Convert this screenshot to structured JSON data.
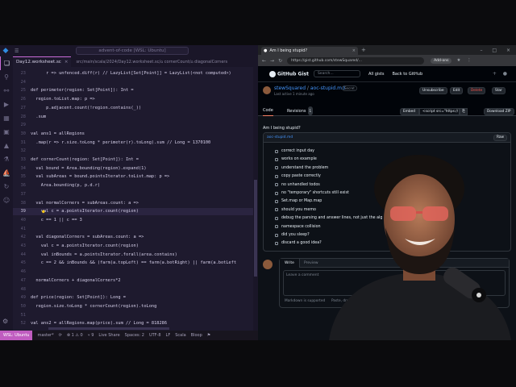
{
  "vscode": {
    "search_placeholder": "advent-of-code [WSL: Ubuntu]",
    "tab_label": "Day12.worksheet.sc",
    "tab_close": "×",
    "breadcrumb": "src/main/scala/2024/Day12.worksheet.sc/⌂ cornerCount/⌂ diagonalCorners",
    "lines": [
      {
        "n": "23",
        "t": "      r => unfenced.diff(r) // LazyList[Set[Point]] = LazyList(<not computed>)"
      },
      {
        "n": "24",
        "t": ""
      },
      {
        "n": "25",
        "t": "def perimeter(region: Set[Point]): Int ="
      },
      {
        "n": "26",
        "t": "  region.toList.map: p =>"
      },
      {
        "n": "27",
        "t": "      p.adjacent.count(!region.contains(_))"
      },
      {
        "n": "28",
        "t": "  .sum"
      },
      {
        "n": "29",
        "t": ""
      },
      {
        "n": "30",
        "t": "val ans1 = allRegions"
      },
      {
        "n": "31",
        "t": "  .map(r => r.size.toLong * perimeter(r).toLong).sum // Long = 1370100"
      },
      {
        "n": "32",
        "t": ""
      },
      {
        "n": "33",
        "t": "def cornerCount(region: Set[Point]): Int ="
      },
      {
        "n": "34",
        "t": "  val bound = Area.bounding(region).expand(1)"
      },
      {
        "n": "35",
        "t": "  val subAreas = bound.pointsIterator.toList.map: p =>"
      },
      {
        "n": "36",
        "t": "    Area.bounding(p, p.d.r)"
      },
      {
        "n": "37",
        "t": ""
      },
      {
        "n": "38",
        "t": "  val normalCorners = subAreas.count: a =>"
      },
      {
        "n": "39",
        "t": "    val c = a.pointsIterator.count(region)"
      },
      {
        "n": "40",
        "t": "    c == 1 || c == 3"
      },
      {
        "n": "41",
        "t": ""
      },
      {
        "n": "42",
        "t": "  val diagonalCorners = subAreas.count: a =>"
      },
      {
        "n": "43",
        "t": "    val c = a.pointsIterator.count(region)"
      },
      {
        "n": "44",
        "t": "    val inBounds = a.pointsIterator.forall(area.contains)"
      },
      {
        "n": "45",
        "t": "    c == 2 && inBounds && (farm(a.topLeft) == farm(a.botRight) || farm(a.botLeft"
      },
      {
        "n": "46",
        "t": ""
      },
      {
        "n": "47",
        "t": "  normalCorners + diagonalCorners*2"
      },
      {
        "n": "48",
        "t": ""
      },
      {
        "n": "49",
        "t": "def price(region: Set[Point]): Long ="
      },
      {
        "n": "50",
        "t": "  region.size.toLong * cornerCount(region).toLong"
      },
      {
        "n": "51",
        "t": ""
      },
      {
        "n": "52",
        "t": "val ans2 = allRegions.map(price).sum // Long = 818286"
      }
    ],
    "status": {
      "remote": "WSL: Ubuntu",
      "branch": "master*",
      "sync": "⟳",
      "problems": "⊗ 1 ⚠ 0",
      "ports": "⑂ 9",
      "live": "Live Share",
      "spaces": "Spaces: 2",
      "encoding": "UTF-8",
      "eol": "LF",
      "lang": "Scala",
      "bloop": "Bloop",
      "bell": "⚑"
    }
  },
  "browser": {
    "tab_title": "Am I being stupid?",
    "url": "https://gist.github.com/stewSquared/...",
    "ext_label": "Add-ons",
    "gh": {
      "logo": "GitHub Gist",
      "search_placeholder": "Search...",
      "all_gists": "All gists",
      "back": "Back to GitHub",
      "user": "stewSquared",
      "gist_name": "aoc-stupid.md",
      "secret": "Secret",
      "sub": "Last active 1 minute ago",
      "btn_unsubscribe": "Unsubscribe",
      "btn_edit": "Edit",
      "btn_delete": "Delete",
      "btn_star": "Star",
      "tab_code": "Code",
      "tab_revisions": "Revisions",
      "revisions_count": "1",
      "embed": "Embed",
      "embed_value": "<script src=\"https://",
      "copy": "⎘",
      "download": "Download ZIP",
      "desc": "Am I being stupid?",
      "file_name": "aoc-stupid.md",
      "raw": "Raw",
      "todos": [
        "correct input day",
        "works on example",
        "understand the problem",
        "copy paste correctly",
        "no unhandled todos",
        "no \"temporary\" shortcuts still exist",
        "Set.map or Map.map",
        "should you memo",
        "debug the parsing and answer lines, not just the alg",
        "namespace collision",
        "did you sleep?",
        "discard a good idea?"
      ],
      "comment_write": "Write",
      "comment_preview": "Preview",
      "comment_placeholder": "Leave a comment",
      "markdown_support": "Markdown is supported",
      "paste_drop": "Paste, drop, or click to add files"
    }
  },
  "colors": {
    "vscode_bg": "#1e1a2e",
    "accent_purple": "#c86bd8",
    "gh_link": "#4493f8",
    "gh_bg": "#0d1117"
  }
}
